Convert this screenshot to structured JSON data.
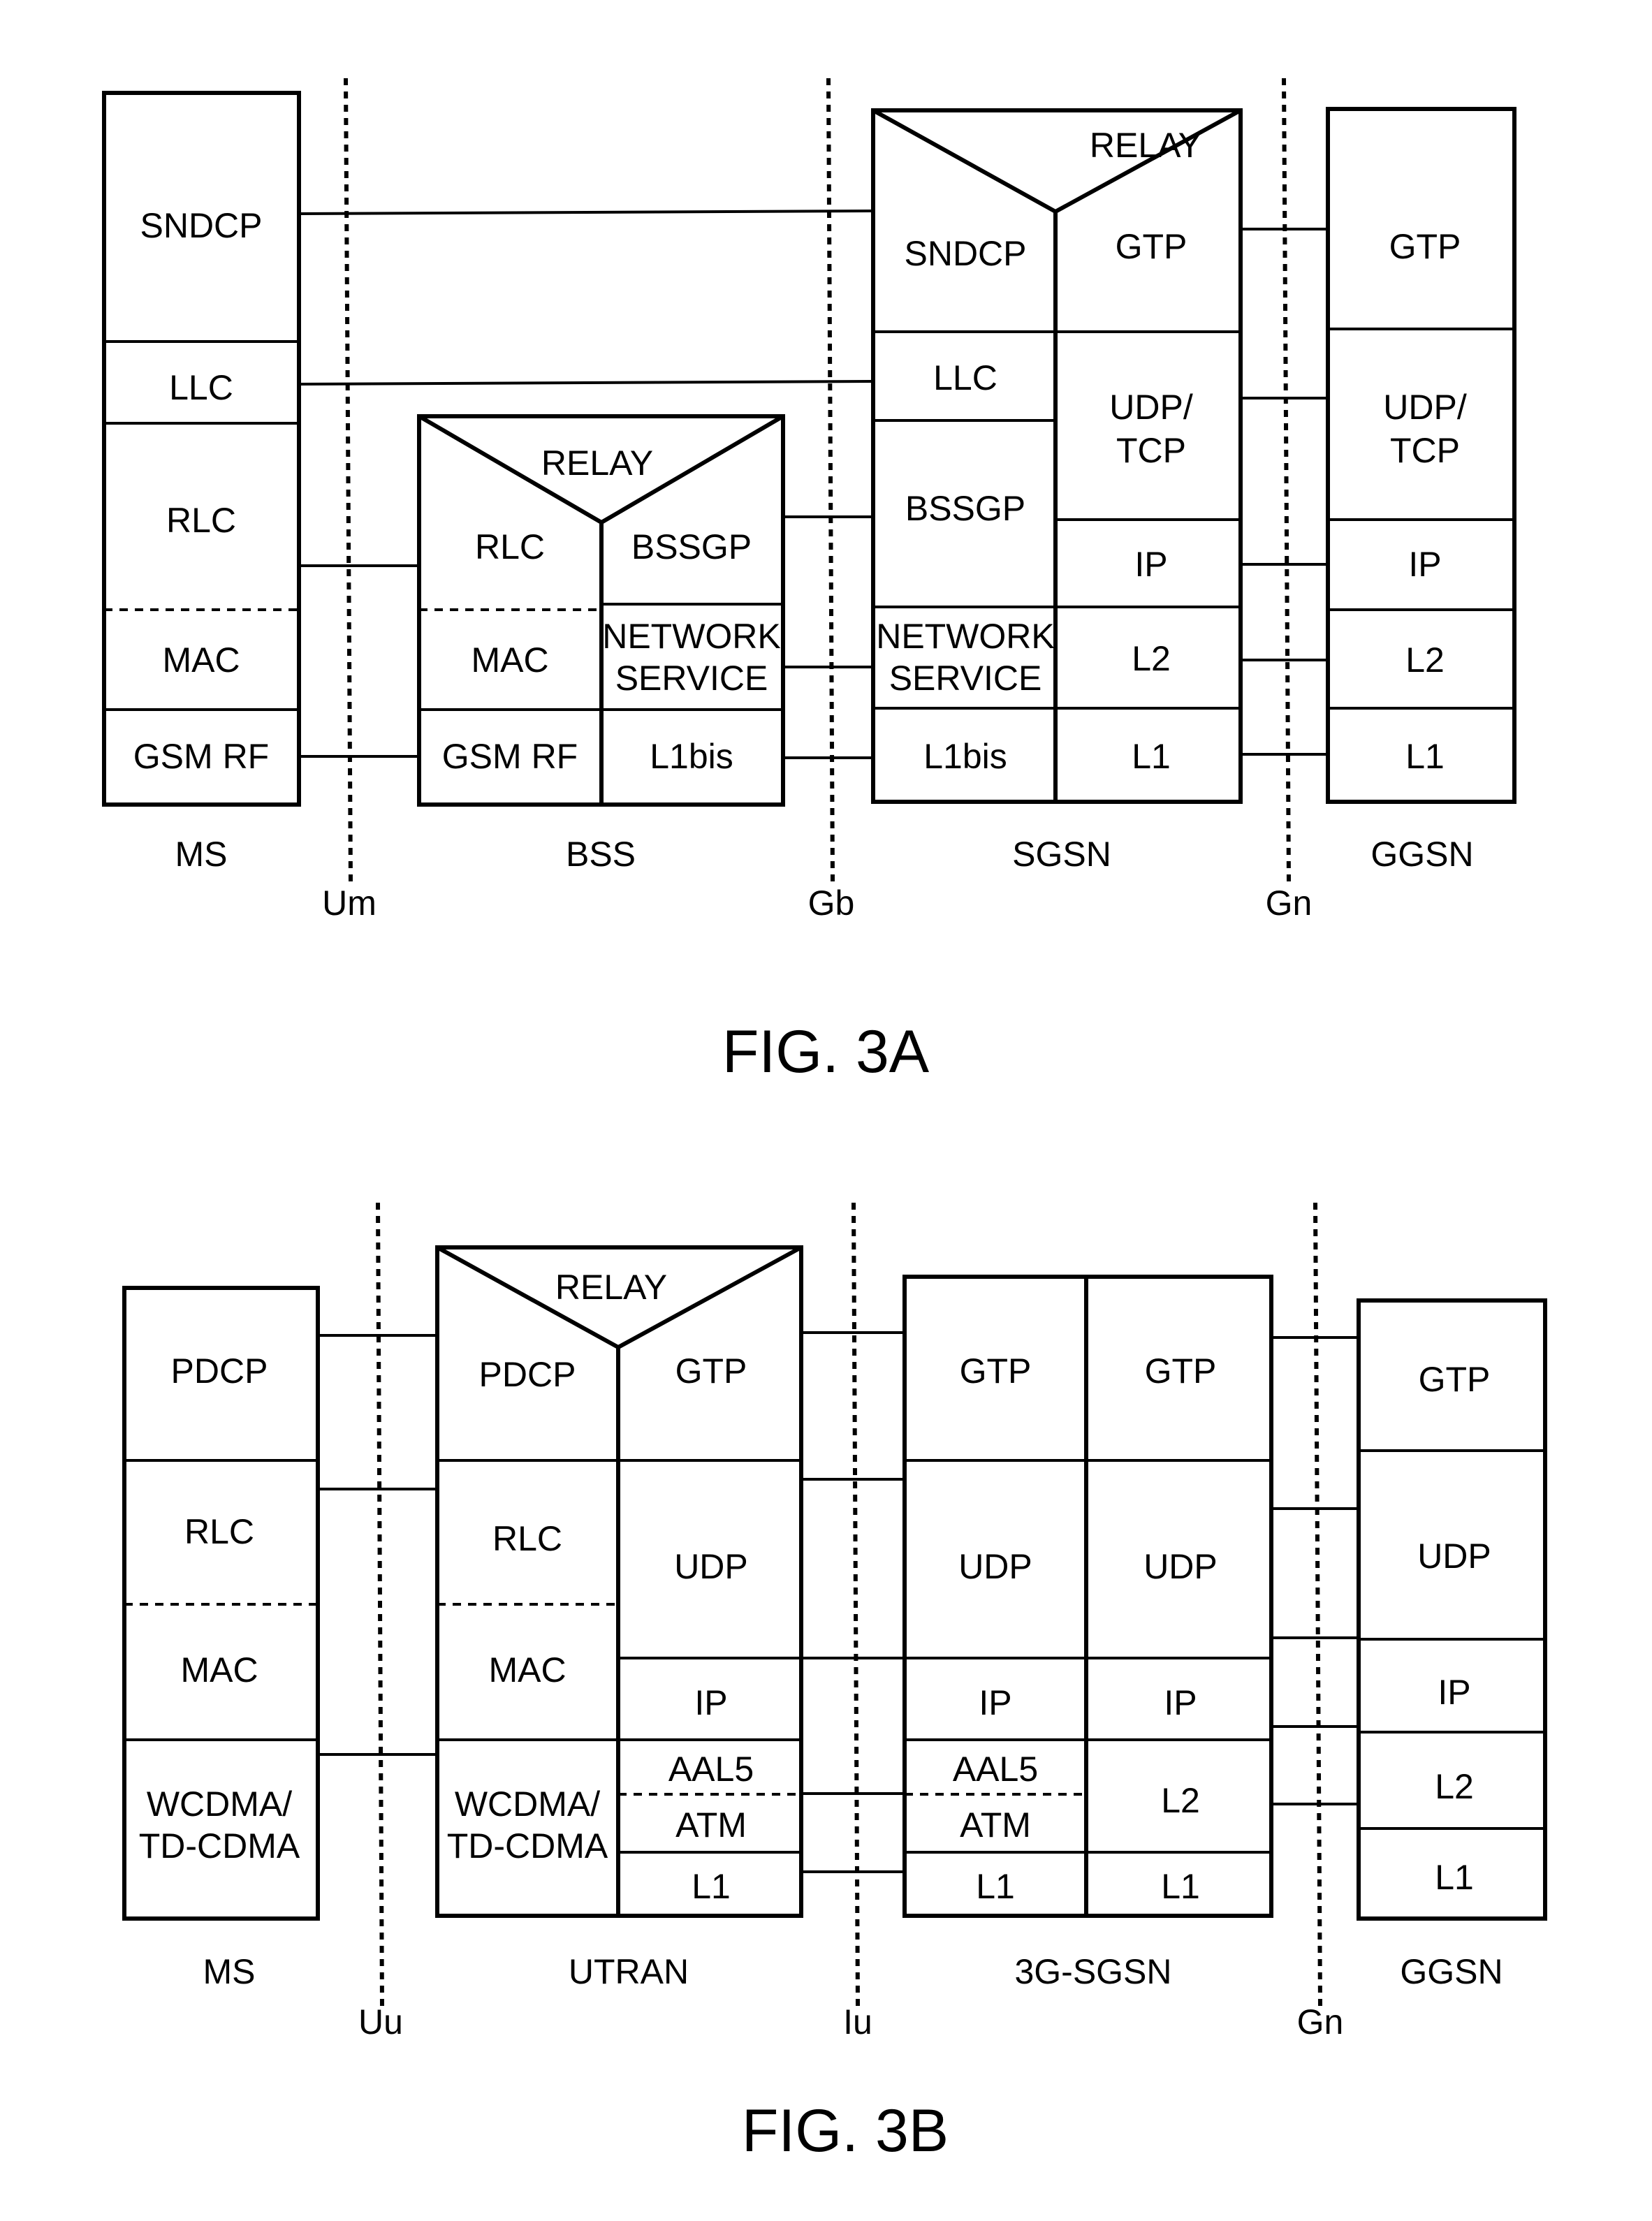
{
  "fig3a": {
    "caption": "FIG. 3A",
    "nodes": {
      "ms": {
        "name": "MS",
        "layers": [
          "SNDCP",
          "LLC",
          "RLC",
          "MAC",
          "GSM RF"
        ]
      },
      "bss": {
        "name": "BSS",
        "relay": "RELAY",
        "left": [
          "RLC",
          "MAC",
          "GSM RF"
        ],
        "right": [
          "BSSGP",
          "NETWORK",
          "SERVICE",
          "L1bis"
        ]
      },
      "sgsn": {
        "name": "SGSN",
        "relay": "RELAY",
        "left": [
          "SNDCP",
          "LLC",
          "BSSGP",
          "NETWORK",
          "SERVICE",
          "L1bis"
        ],
        "right": [
          "GTP",
          "UDP/",
          "TCP",
          "IP",
          "L2",
          "L1"
        ]
      },
      "ggsn": {
        "name": "GGSN",
        "layers": [
          "GTP",
          "UDP/",
          "TCP",
          "IP",
          "L2",
          "L1"
        ]
      }
    },
    "interfaces": [
      "Um",
      "Gb",
      "Gn"
    ]
  },
  "fig3b": {
    "caption": "FIG. 3B",
    "nodes": {
      "ms": {
        "name": "MS",
        "layers": [
          "PDCP",
          "RLC",
          "MAC",
          "WCDMA/",
          "TD-CDMA"
        ]
      },
      "utran": {
        "name": "UTRAN",
        "relay": "RELAY",
        "left": [
          "PDCP",
          "RLC",
          "MAC",
          "WCDMA/",
          "TD-CDMA"
        ],
        "right": [
          "GTP",
          "UDP",
          "IP",
          "AAL5",
          "ATM",
          "L1"
        ]
      },
      "sgsn3g": {
        "name": "3G-SGSN",
        "left": [
          "GTP",
          "UDP",
          "IP",
          "AAL5",
          "ATM",
          "L1"
        ],
        "right": [
          "GTP",
          "UDP",
          "IP",
          "L2",
          "L1"
        ]
      },
      "ggsn": {
        "name": "GGSN",
        "layers": [
          "GTP",
          "UDP",
          "IP",
          "L2",
          "L1"
        ]
      }
    },
    "interfaces": [
      "Uu",
      "Iu",
      "Gn"
    ]
  }
}
